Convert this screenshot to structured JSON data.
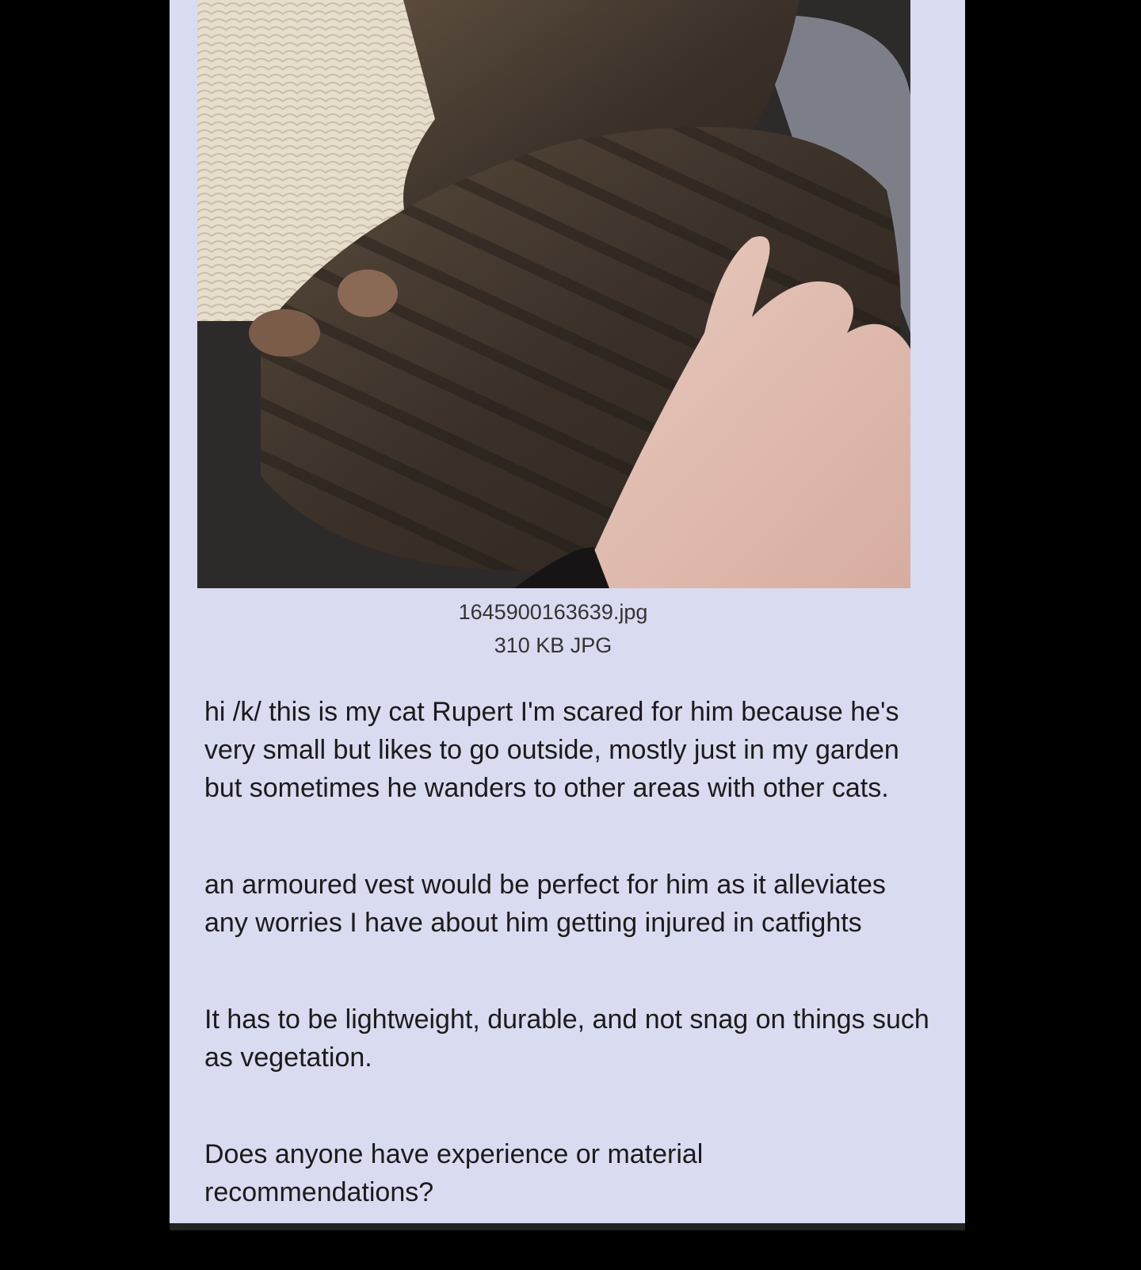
{
  "post": {
    "image": {
      "alt": "tabby cat being petted next to a sisal scratching post",
      "filename": "1645900163639.jpg",
      "filesize": "310 KB JPG"
    },
    "paragraphs": [
      "hi /k/ this is my cat Rupert I'm scared for him because he's very small but likes to go outside, mostly just in my garden but sometimes he wanders to other areas with other cats.",
      "an armoured vest would be perfect for him as it alleviates any worries I have about him getting injured in catfights",
      "It has to be lightweight, durable, and not snag on things such as vegetation.",
      "Does anyone have experience or material recommendations?"
    ]
  },
  "colors": {
    "page_background": "#000000",
    "post_background": "#d9dbf0",
    "text": "#1b1b1b"
  }
}
